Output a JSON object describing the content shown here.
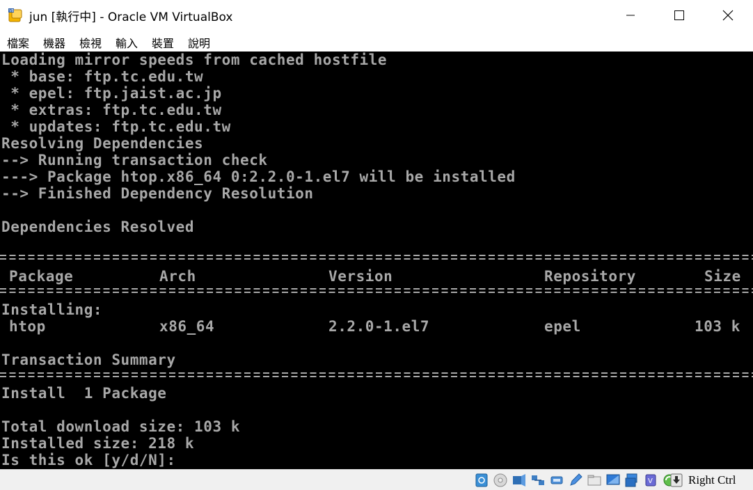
{
  "window": {
    "title": "jun [執行中] - Oracle VM VirtualBox"
  },
  "menu": [
    "檔案",
    "機器",
    "檢視",
    "輸入",
    "裝置",
    "說明"
  ],
  "console": {
    "lines_top": [
      "Loading mirror speeds from cached hostfile",
      " * base: ftp.tc.edu.tw",
      " * epel: ftp.jaist.ac.jp",
      " * extras: ftp.tc.edu.tw",
      " * updates: ftp.tc.edu.tw",
      "Resolving Dependencies",
      "--> Running transaction check",
      "---> Package htop.x86_64 0:2.2.0-1.el7 will be installed",
      "--> Finished Dependency Resolution",
      "",
      "Dependencies Resolved"
    ],
    "table": {
      "headers": [
        "Package",
        "Arch",
        "Version",
        "Repository",
        "Size"
      ],
      "group_label": "Installing:",
      "rows": [
        [
          "htop",
          "x86_64",
          "2.2.0-1.el7",
          "epel",
          "103 k"
        ]
      ]
    },
    "summary_title": "Transaction Summary",
    "install_line": "Install  1 Package",
    "lines_bottom": [
      "Total download size: 103 k",
      "Installed size: 218 k",
      "Is this ok [y/d/N]:"
    ]
  },
  "statusbar": {
    "icons": [
      "hard-disk-icon",
      "optical-drive-icon",
      "audio-icon",
      "network-icon",
      "usb-icon",
      "pencil-icon",
      "shared-folders-icon",
      "display-icon",
      "video-capture-icon",
      "cpu-icon",
      "mouse-integration-icon",
      "keyboard-capture-icon",
      "host-key-arrow-icon"
    ],
    "host_key": "Right Ctrl"
  },
  "colors": {
    "console_bg": "#000000",
    "console_fg": "#a8a8a8",
    "statusbar_bg": "#f0f0f0"
  }
}
